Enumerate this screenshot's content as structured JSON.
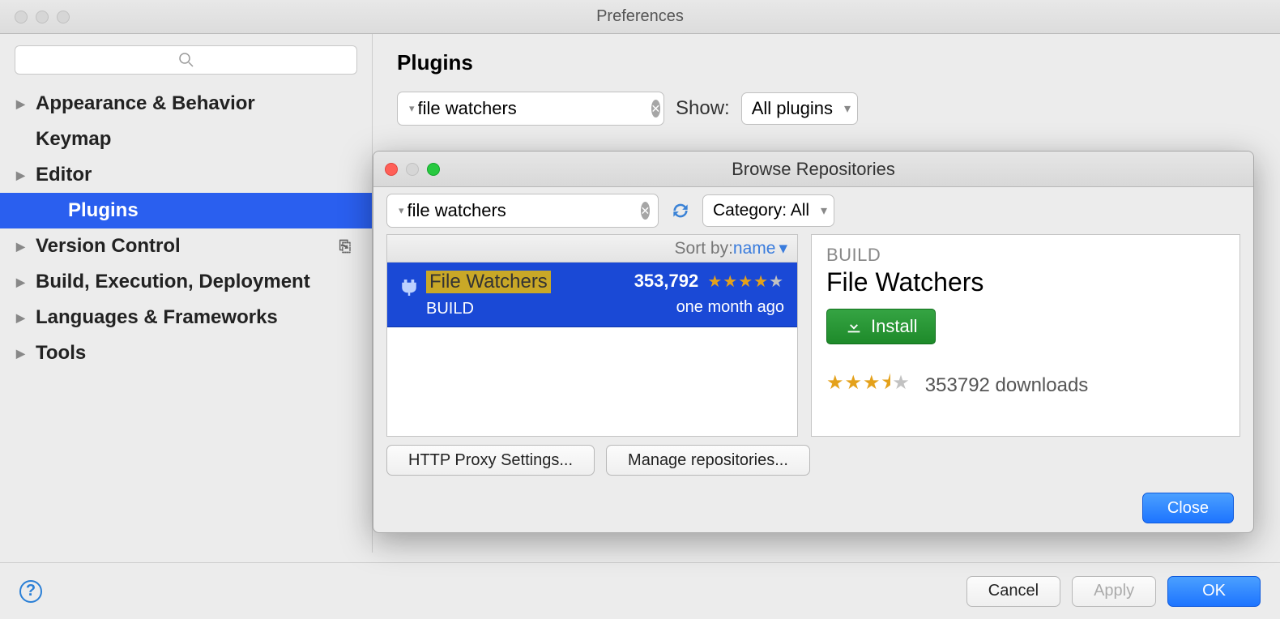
{
  "window": {
    "title": "Preferences"
  },
  "sidebar": {
    "items": [
      {
        "label": "Appearance & Behavior",
        "expandable": true
      },
      {
        "label": "Keymap",
        "expandable": false
      },
      {
        "label": "Editor",
        "expandable": true
      },
      {
        "label": "Plugins",
        "expandable": false,
        "selected": true,
        "indent": true
      },
      {
        "label": "Version Control",
        "expandable": true,
        "trailing_icon": true
      },
      {
        "label": "Build, Execution, Deployment",
        "expandable": true
      },
      {
        "label": "Languages & Frameworks",
        "expandable": true
      },
      {
        "label": "Tools",
        "expandable": true
      }
    ]
  },
  "content": {
    "heading": "Plugins",
    "search_value": "file watchers",
    "show_label": "Show:",
    "show_option": "All plugins"
  },
  "modal": {
    "title": "Browse Repositories",
    "search_value": "file watchers",
    "category_label": "Category: All",
    "sort_prefix": "Sort by: ",
    "sort_value": "name",
    "result": {
      "name": "File Watchers",
      "category": "BUILD",
      "download_count": "353,792",
      "age": "one month ago"
    },
    "detail": {
      "category": "BUILD",
      "name": "File Watchers",
      "install_label": "Install",
      "downloads_line": "353792 downloads"
    },
    "proxy_button": "HTTP Proxy Settings...",
    "manage_button": "Manage repositories...",
    "close_button": "Close"
  },
  "footer": {
    "cancel": "Cancel",
    "apply": "Apply",
    "ok": "OK"
  }
}
